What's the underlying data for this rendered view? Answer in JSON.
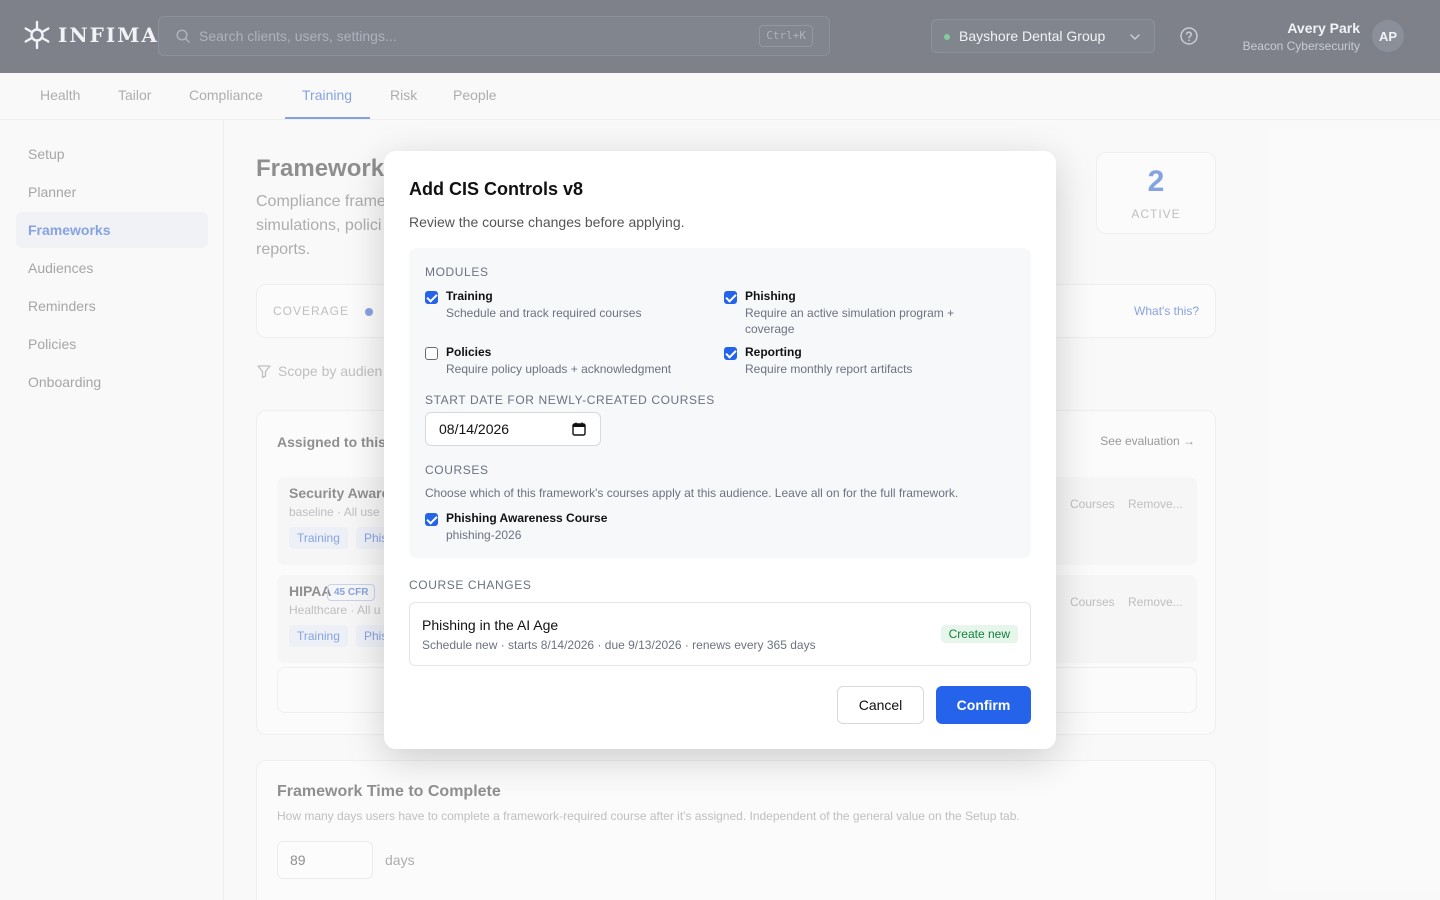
{
  "brand": {
    "name": "INFIMA",
    "logo_icon": "snowflake-icon"
  },
  "search": {
    "placeholder": "Search clients, users, settings...",
    "shortcut": "Ctrl+K"
  },
  "org_selector": {
    "value": "Bayshore Dental Group",
    "status_color": "#1fa34a"
  },
  "user": {
    "name": "Avery Park",
    "org": "Beacon Cybersecurity",
    "initials": "AP"
  },
  "tabs": [
    {
      "label": "Health"
    },
    {
      "label": "Tailor"
    },
    {
      "label": "Compliance"
    },
    {
      "label": "Training",
      "active": true
    },
    {
      "label": "Risk"
    },
    {
      "label": "People"
    }
  ],
  "sidebar": {
    "items": [
      {
        "label": "Setup"
      },
      {
        "label": "Planner"
      },
      {
        "label": "Frameworks",
        "active": true
      },
      {
        "label": "Audiences"
      },
      {
        "label": "Reminders"
      },
      {
        "label": "Policies"
      },
      {
        "label": "Onboarding"
      }
    ]
  },
  "page": {
    "title": "Frameworks",
    "description": "Compliance frame simulations, polici reports.",
    "active_count": "2",
    "active_label": "ACTIVE",
    "coverage_label": "COVERAGE",
    "whats_this": "What's this?",
    "scope_label": "Scope by audien",
    "assigned_title": "Assigned to this",
    "see_evaluation": "See evaluation →",
    "frameworks": [
      {
        "name": "Security Aware",
        "sub": "baseline · All use",
        "tags": [
          "Training",
          "Phis"
        ],
        "courses_link": "Courses",
        "remove_link": "Remove..."
      },
      {
        "name": "HIPAA",
        "badge": "45 CFR",
        "sub": "Healthcare · All u",
        "tags": [
          "Training",
          "Phis"
        ],
        "courses_link": "Courses",
        "remove_link": "Remove..."
      }
    ],
    "ttc": {
      "title": "Framework Time to Complete",
      "description": "How many days users have to complete a framework-required course after it's assigned. Independent of the general value on the Setup tab.",
      "value": "89",
      "unit": "days"
    }
  },
  "modal": {
    "title": "Add CIS Controls v8",
    "subtitle": "Review the course changes before applying.",
    "modules_label": "MODULES",
    "modules": [
      {
        "title": "Training",
        "desc": "Schedule and track required courses",
        "checked": true
      },
      {
        "title": "Phishing",
        "desc": "Require an active simulation program + coverage",
        "checked": true
      },
      {
        "title": "Policies",
        "desc": "Require policy uploads + acknowledgment",
        "checked": false
      },
      {
        "title": "Reporting",
        "desc": "Require monthly report artifacts",
        "checked": true
      }
    ],
    "start_date_label": "START DATE FOR NEWLY-CREATED COURSES",
    "start_date_value": "08/14/2026",
    "courses_label": "COURSES",
    "courses_help": "Choose which of this framework's courses apply at this audience. Leave all on for the full framework.",
    "courses": [
      {
        "title": "Phishing Awareness Course",
        "desc": "phishing-2026",
        "checked": true
      }
    ],
    "changes_label": "COURSE CHANGES",
    "change": {
      "title": "Phishing in the AI Age",
      "details": "Schedule new · starts 8/14/2026 · due 9/13/2026 · renews every 365 days",
      "badge": "Create new"
    },
    "cancel_label": "Cancel",
    "confirm_label": "Confirm",
    "accent_color": "#2563eb"
  }
}
